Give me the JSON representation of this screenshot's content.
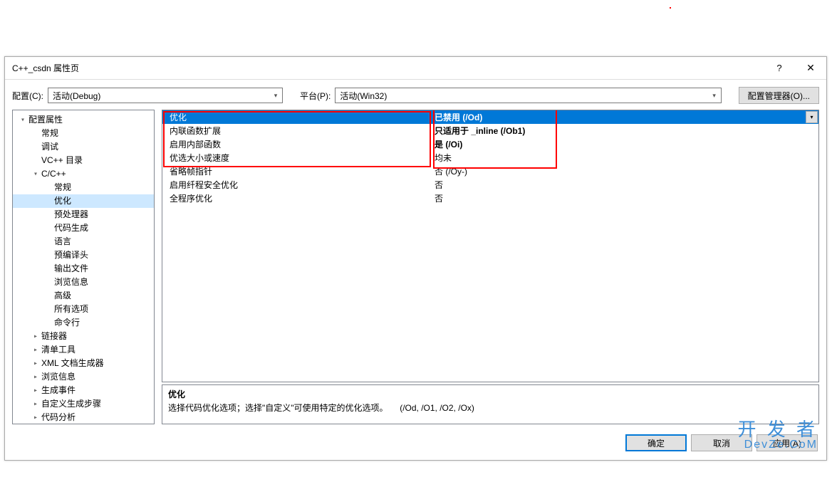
{
  "window": {
    "title": "C++_csdn 属性页",
    "help": "?",
    "close": "✕"
  },
  "toolbar": {
    "config_label": "配置(C):",
    "config_value": "活动(Debug)",
    "platform_label": "平台(P):",
    "platform_value": "活动(Win32)",
    "config_mgr_label": "配置管理器(O)..."
  },
  "tree": {
    "root": "配置属性",
    "items_top": [
      "常规",
      "调试",
      "VC++ 目录"
    ],
    "cpp_label": "C/C++",
    "cpp_items": [
      "常规",
      "优化",
      "预处理器",
      "代码生成",
      "语言",
      "预编译头",
      "输出文件",
      "浏览信息",
      "高级",
      "所有选项",
      "命令行"
    ],
    "cpp_selected": "优化",
    "items_bottom": [
      "链接器",
      "清单工具",
      "XML 文档生成器",
      "浏览信息",
      "生成事件",
      "自定义生成步骤",
      "代码分析"
    ]
  },
  "grid": {
    "rows": [
      {
        "label": "优化",
        "value": "已禁用 (/Od)",
        "selected": true,
        "bold": true
      },
      {
        "label": "内联函数扩展",
        "value": "只适用于 _inline (/Ob1)",
        "bold": true
      },
      {
        "label": "启用内部函数",
        "value": "是 (/Oi)",
        "bold": true
      },
      {
        "label": "优选大小或速度",
        "value": "均未"
      },
      {
        "label": "省略帧指针",
        "value": "否 (/Oy-)"
      },
      {
        "label": "启用纤程安全优化",
        "value": "否"
      },
      {
        "label": "全程序优化",
        "value": "否"
      }
    ]
  },
  "desc": {
    "title": "优化",
    "text_a": "选择代码优化选项；选择\"自定义\"可使用特定的优化选项。",
    "text_b": "(/Od, /O1, /O2, /Ox)"
  },
  "footer": {
    "ok": "确定",
    "cancel": "取消",
    "apply": "应用(A)"
  },
  "watermark": {
    "line1": "开 发 者",
    "line2": "DevZe.CoM"
  }
}
